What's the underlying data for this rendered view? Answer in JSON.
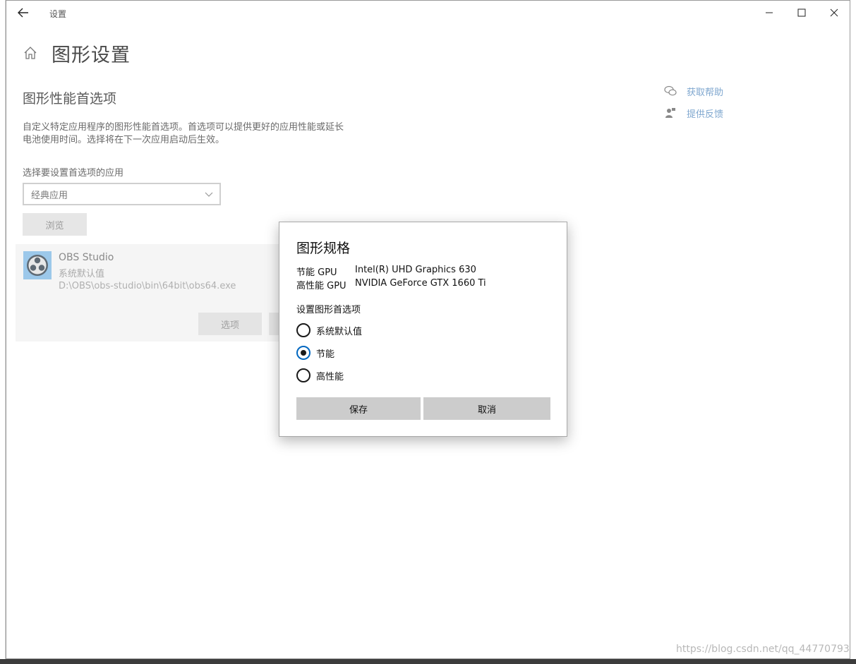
{
  "window": {
    "title": "设置",
    "back_icon": "arrow-left-icon",
    "controls": {
      "minimize_icon": "minimize-icon",
      "maximize_icon": "maximize-icon",
      "close_icon": "close-icon"
    }
  },
  "header": {
    "home_icon": "home-icon",
    "page_title": "图形设置"
  },
  "main": {
    "section_title": "图形性能首选项",
    "description": "自定义特定应用程序的图形性能首选项。首选项可以提供更好的应用性能或延长电池使用时间。选择将在下一次应用启动后生效。",
    "select_label": "选择要设置首选项的应用",
    "app_type_value": "经典应用",
    "browse_label": "浏览",
    "app": {
      "name": "OBS Studio",
      "preference": "系统默认值",
      "path": "D:\\OBS\\obs-studio\\bin\\64bit\\obs64.exe",
      "options_label": "选项"
    }
  },
  "help": {
    "get_help": "获取帮助",
    "feedback": "提供反馈"
  },
  "dialog": {
    "title": "图形规格",
    "gpus": [
      {
        "label": "节能 GPU",
        "value": "Intel(R) UHD Graphics 630"
      },
      {
        "label": "高性能 GPU",
        "value": "NVIDIA GeForce GTX 1660 Ti"
      }
    ],
    "pref_label": "设置图形首选项",
    "options": [
      {
        "label": "系统默认值",
        "checked": false
      },
      {
        "label": "节能",
        "checked": true
      },
      {
        "label": "高性能",
        "checked": false
      }
    ],
    "save_label": "保存",
    "cancel_label": "取消"
  },
  "watermark": "https://blog.csdn.net/qq_44770793",
  "colors": {
    "accent": "#0067c0",
    "link": "#7fa7cf",
    "button_gray": "#cccccc"
  }
}
